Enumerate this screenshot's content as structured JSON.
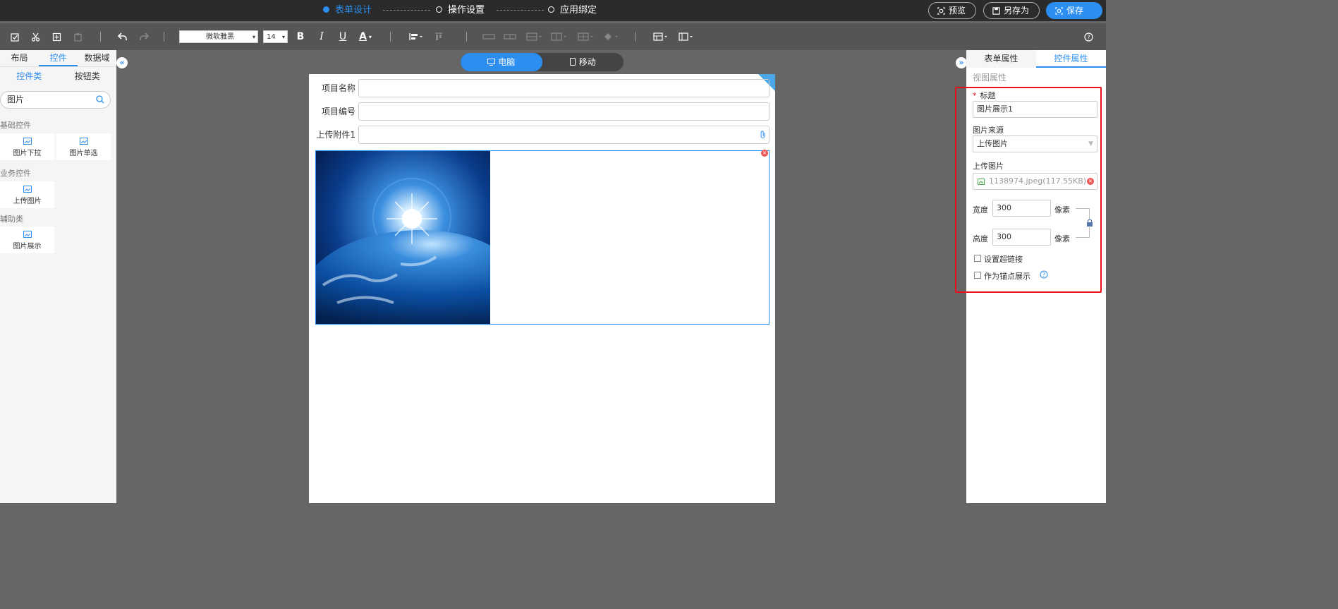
{
  "steps": [
    {
      "label": "表单设计",
      "active": true
    },
    {
      "label": "操作设置",
      "active": false
    },
    {
      "label": "应用绑定",
      "active": false
    }
  ],
  "actions": {
    "preview": "预览",
    "save_as": "另存为",
    "save": "保存"
  },
  "toolbar": {
    "font_family": "微软雅黑",
    "font_size": "14",
    "bold": "B",
    "italic": "I",
    "underline": "U",
    "font_color": "A"
  },
  "left": {
    "tabs": [
      "布局",
      "控件",
      "数据域"
    ],
    "subtabs": [
      "控件类",
      "按钮类"
    ],
    "search_value": "图片",
    "groups": {
      "basic": {
        "title": "基础控件",
        "items": [
          "图片下拉",
          "图片单选"
        ]
      },
      "business": {
        "title": "业务控件",
        "items": [
          "上传图片"
        ]
      },
      "aux": {
        "title": "辅助类",
        "items": [
          "图片展示"
        ]
      }
    }
  },
  "device": {
    "desktop": "电脑",
    "mobile": "移动"
  },
  "form": {
    "fields": [
      {
        "label": "项目名称",
        "value": ""
      },
      {
        "label": "项目编号",
        "value": ""
      },
      {
        "label": "上传附件1",
        "value": ""
      }
    ]
  },
  "right": {
    "tabs": [
      "表单属性",
      "控件属性"
    ],
    "section": "视图属性",
    "title_label": "标题",
    "title_value": "图片展示1",
    "source_label": "图片来源",
    "source_value": "上传图片",
    "upload_label": "上传图片",
    "upload_file": "1138974.jpeg(117.55KB)",
    "width_label": "宽度",
    "width_value": "300",
    "height_label": "高度",
    "height_value": "300",
    "unit": "像素",
    "hyperlink_label": "设置超链接",
    "anchor_label": "作为锚点展示"
  },
  "colors": {
    "accent": "#2b8ef0",
    "highlight": "#e8101a",
    "topbar": "#2b2b2b",
    "toolbar": "#555555"
  }
}
